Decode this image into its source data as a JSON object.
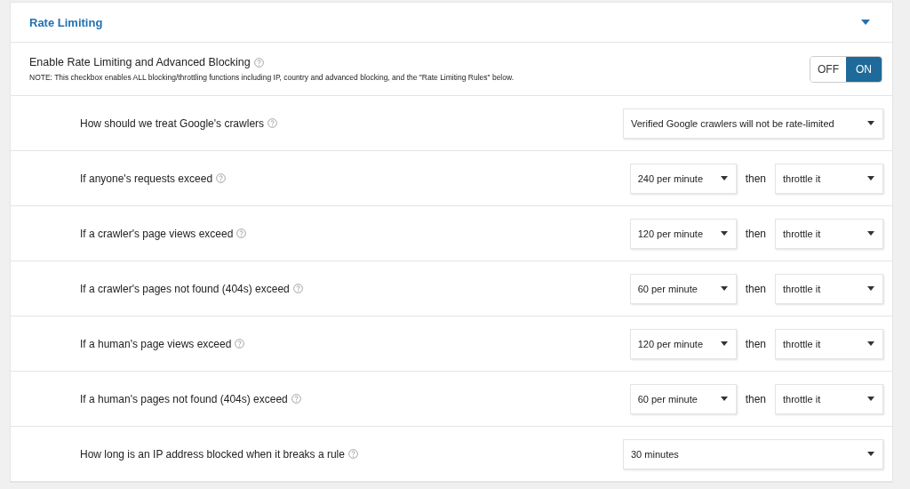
{
  "section": {
    "title": "Rate Limiting",
    "expanded": true
  },
  "master": {
    "label": "Enable Rate Limiting and Advanced Blocking",
    "note": "NOTE: This checkbox enables ALL blocking/throttling functions including IP, country and advanced blocking, and the \"Rate Limiting Rules\" below.",
    "options": [
      {
        "label": "OFF",
        "selected": false
      },
      {
        "label": "ON",
        "selected": true
      }
    ]
  },
  "rules": [
    {
      "kind": "single",
      "label": "How should we treat Google's crawlers",
      "value": "Verified Google crawlers will not be rate-limited"
    },
    {
      "kind": "pair",
      "label": "If anyone's requests exceed",
      "value": "240 per minute",
      "joiner": "then",
      "action": "throttle it"
    },
    {
      "kind": "pair",
      "label": "If a crawler's page views exceed",
      "value": "120 per minute",
      "joiner": "then",
      "action": "throttle it"
    },
    {
      "kind": "pair",
      "label": "If a crawler's pages not found (404s) exceed",
      "value": "60 per minute",
      "joiner": "then",
      "action": "throttle it"
    },
    {
      "kind": "pair",
      "label": "If a human's page views exceed",
      "value": "120 per minute",
      "joiner": "then",
      "action": "throttle it"
    },
    {
      "kind": "pair",
      "label": "If a human's pages not found (404s) exceed",
      "value": "60 per minute",
      "joiner": "then",
      "action": "throttle it"
    },
    {
      "kind": "single",
      "label": "How long is an IP address blocked when it breaks a rule",
      "value": "30 minutes"
    }
  ]
}
